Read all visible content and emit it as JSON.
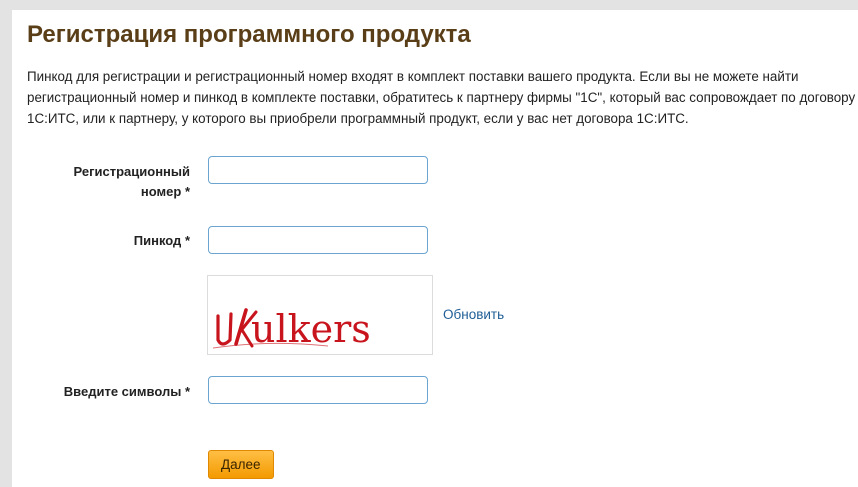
{
  "page": {
    "title": "Регистрация программного продукта",
    "intro": "Пинкод для регистрации и регистрационный номер входят в комплект поставки вашего продукта. Если вы не можете найти регистрационный номер и пинкод в комплекте поставки, обратитесь к партнеру фирмы \"1С\", который вас сопровождает по договору 1С:ИТС, или к партнеру, у которого вы приобрели программный продукт, если у вас нет договора 1С:ИТС."
  },
  "form": {
    "reg_number": {
      "label_line1": "Регистрационный",
      "label_line2": "номер",
      "required_mark": "*",
      "value": ""
    },
    "pincode": {
      "label": "Пинкод",
      "required_mark": "*",
      "value": ""
    },
    "captcha": {
      "image_text": "ulkers",
      "refresh_label": "Обновить",
      "input_label": "Введите символы",
      "required_mark": "*",
      "value": ""
    },
    "submit_label": "Далее"
  },
  "colors": {
    "title": "#5a3e17",
    "link": "#1d5e96",
    "button": "#f39a00",
    "input_border": "#6aa4cf",
    "captcha_text": "#c8141c"
  }
}
